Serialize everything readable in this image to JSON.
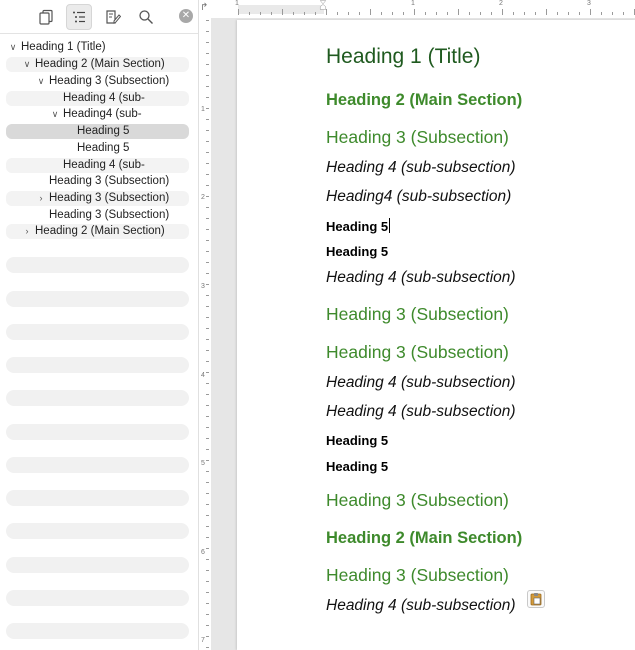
{
  "sidebar": {
    "tools": [
      {
        "name": "pages-icon"
      },
      {
        "name": "outline-icon"
      },
      {
        "name": "edit-notes-icon"
      },
      {
        "name": "search-icon"
      }
    ],
    "close_glyph": "✕",
    "items": [
      {
        "label": "Heading 1 (Title)",
        "chevron": "∨"
      },
      {
        "label": "Heading 2 (Main Section)",
        "chevron": "∨"
      },
      {
        "label": "Heading 3 (Subsection)",
        "chevron": "∨"
      },
      {
        "label": "Heading 4 (sub-",
        "chevron": ""
      },
      {
        "label": "Heading4 (sub-",
        "chevron": "∨"
      },
      {
        "label": "Heading 5",
        "chevron": ""
      },
      {
        "label": "Heading 5",
        "chevron": ""
      },
      {
        "label": "Heading 4 (sub-",
        "chevron": ""
      },
      {
        "label": "Heading 3 (Subsection)",
        "chevron": ""
      },
      {
        "label": "Heading 3 (Subsection)",
        "chevron": "›"
      },
      {
        "label": "Heading 3 (Subsection)",
        "chevron": ""
      },
      {
        "label": "Heading 2 (Main Section)",
        "chevron": "›"
      }
    ]
  },
  "ruler": {
    "h_numbers": [
      "1",
      "1",
      "2",
      "3"
    ],
    "v_numbers": [
      "1",
      "2",
      "3",
      "4",
      "5",
      "6",
      "7"
    ]
  },
  "document": {
    "lines": [
      {
        "text": "Heading 1 (Title)",
        "style": "h1"
      },
      {
        "text": "Heading 2 (Main Section)",
        "style": "h2"
      },
      {
        "text": "Heading 3 (Subsection)",
        "style": "h3"
      },
      {
        "text": "Heading 4 (sub-subsection)",
        "style": "h4"
      },
      {
        "text": "Heading4 (sub-subsection)",
        "style": "h4"
      },
      {
        "text": "Heading 5",
        "style": "h5"
      },
      {
        "text": "Heading 5",
        "style": "h5"
      },
      {
        "text": "Heading 4 (sub-subsection)",
        "style": "h4"
      },
      {
        "text": "Heading 3 (Subsection)",
        "style": "h3"
      },
      {
        "text": "Heading 3 (Subsection)",
        "style": "h3"
      },
      {
        "text": "Heading 4 (sub-subsection)",
        "style": "h4"
      },
      {
        "text": "Heading 4 (sub-subsection)",
        "style": "h4"
      },
      {
        "text": "Heading 5",
        "style": "h5"
      },
      {
        "text": "Heading 5",
        "style": "h5"
      },
      {
        "text": "Heading 3 (Subsection)",
        "style": "h3"
      },
      {
        "text": "Heading 2 (Main Section)",
        "style": "h2"
      },
      {
        "text": "Heading 3 (Subsection)",
        "style": "h3"
      },
      {
        "text": "Heading 4 (sub-subsection)",
        "style": "h4"
      }
    ]
  },
  "colors": {
    "heading1": "#1f5a1f",
    "heading_green": "#3e8a2c",
    "selected_row": "#d9d9d9"
  }
}
